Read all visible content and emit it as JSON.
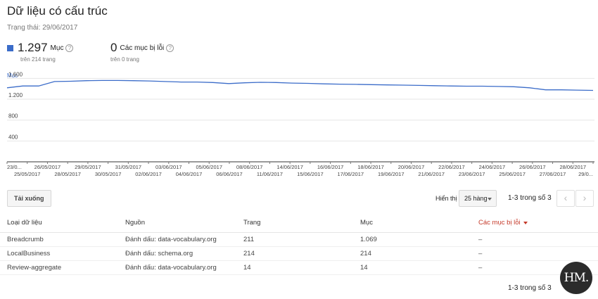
{
  "header": {
    "title": "Dữ liệu có cấu trúc",
    "status": "Trạng thái: 29/06/2017"
  },
  "metrics": {
    "items_count": "1.297",
    "items_label": "Mục",
    "items_sub": "trên 214 trang",
    "errors_count": "0",
    "errors_label": "Các mục bị lỗi",
    "errors_sub": "trên 0 trang",
    "series_color": "#3b6cc9"
  },
  "chart_data": {
    "type": "line",
    "ylabel": "Mục",
    "yticks": [
      1600,
      1200,
      800,
      400
    ],
    "ytick_labels": [
      "1.600",
      "1.200",
      "800",
      "400"
    ],
    "ylim": [
      0,
      1700
    ],
    "grid": true,
    "x_tick_labels": [
      "23/0...",
      "25/05/2017",
      "26/05/2017",
      "28/05/2017",
      "29/05/2017",
      "30/05/2017",
      "31/05/2017",
      "02/06/2017",
      "03/06/2017",
      "04/06/2017",
      "05/06/2017",
      "06/06/2017",
      "08/06/2017",
      "11/06/2017",
      "14/06/2017",
      "15/06/2017",
      "16/06/2017",
      "17/06/2017",
      "18/06/2017",
      "19/06/2017",
      "20/06/2017",
      "21/06/2017",
      "22/06/2017",
      "23/06/2017",
      "24/06/2017",
      "25/06/2017",
      "26/06/2017",
      "27/06/2017",
      "28/06/2017",
      "29/0..."
    ],
    "series": [
      {
        "color": "#3b6cc9",
        "values": [
          1420,
          1455,
          1455,
          1540,
          1545,
          1555,
          1560,
          1560,
          1555,
          1550,
          1540,
          1530,
          1530,
          1520,
          1500,
          1515,
          1525,
          1520,
          1510,
          1505,
          1495,
          1490,
          1485,
          1480,
          1475,
          1470,
          1465,
          1460,
          1455,
          1450,
          1450,
          1445,
          1440,
          1420,
          1380,
          1380,
          1375,
          1370
        ]
      }
    ]
  },
  "toolbar": {
    "download_label": "Tải xuống",
    "rows_label": "Hiển thị",
    "rows_value": "25 hàng",
    "pager_text": "1-3 trong số 3",
    "prev_icon": "‹",
    "next_icon": "›"
  },
  "table": {
    "columns": [
      "Loại dữ liệu",
      "Nguồn",
      "Trang",
      "Mục",
      "Các mục bị lỗi"
    ],
    "rows": [
      [
        "Breadcrumb",
        "Đánh dấu: data-vocabulary.org",
        "211",
        "1.069",
        "–"
      ],
      [
        "LocalBusiness",
        "Đánh dấu: schema.org",
        "214",
        "214",
        "–"
      ],
      [
        "Review-aggregate",
        "Đánh dấu: data-vocabulary.org",
        "14",
        "14",
        "–"
      ]
    ]
  },
  "footer": {
    "pager_text": "1-3 trong số 3",
    "logo_text": "HM."
  }
}
